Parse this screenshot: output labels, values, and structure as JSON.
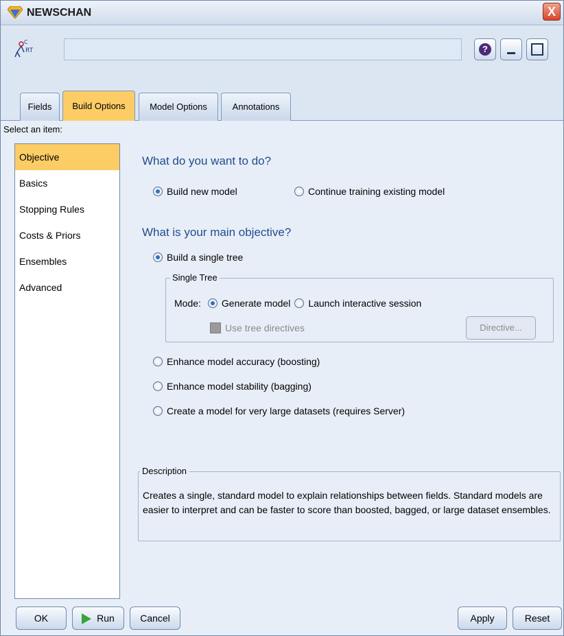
{
  "window": {
    "title": "NEWSCHAN",
    "close_label": "X"
  },
  "header": {
    "node_name": "",
    "help_label": "?"
  },
  "tabs": [
    {
      "label": "Fields"
    },
    {
      "label": "Build Options"
    },
    {
      "label": "Model Options"
    },
    {
      "label": "Annotations"
    }
  ],
  "select_label": "Select an item:",
  "items": [
    {
      "label": "Objective"
    },
    {
      "label": "Basics"
    },
    {
      "label": "Stopping Rules"
    },
    {
      "label": "Costs & Priors"
    },
    {
      "label": "Ensembles"
    },
    {
      "label": "Advanced"
    }
  ],
  "main": {
    "q1": "What do you want to do?",
    "build_new": "Build new model",
    "continue_training": "Continue training existing model",
    "q2": "What is your main objective?",
    "single_tree": "Build a single tree",
    "group_title": "Single Tree",
    "mode_label": "Mode:",
    "generate_model": "Generate model",
    "launch_interactive": "Launch interactive session",
    "use_directives": "Use tree directives",
    "directive_button": "Directive...",
    "boosting": "Enhance model accuracy (boosting)",
    "bagging": "Enhance model stability (bagging)",
    "large_datasets": "Create a model for very large datasets (requires Server)",
    "description_title": "Description",
    "description_text": "Creates a single, standard model to explain relationships between fields.  Standard models are easier to interpret and can be faster to score than boosted, bagged, or large dataset ensembles."
  },
  "buttons": {
    "ok": "OK",
    "run": "Run",
    "cancel": "Cancel",
    "apply": "Apply",
    "reset": "Reset"
  },
  "colors": {
    "accent": "#fccd65",
    "heading": "#1f4d8f"
  }
}
